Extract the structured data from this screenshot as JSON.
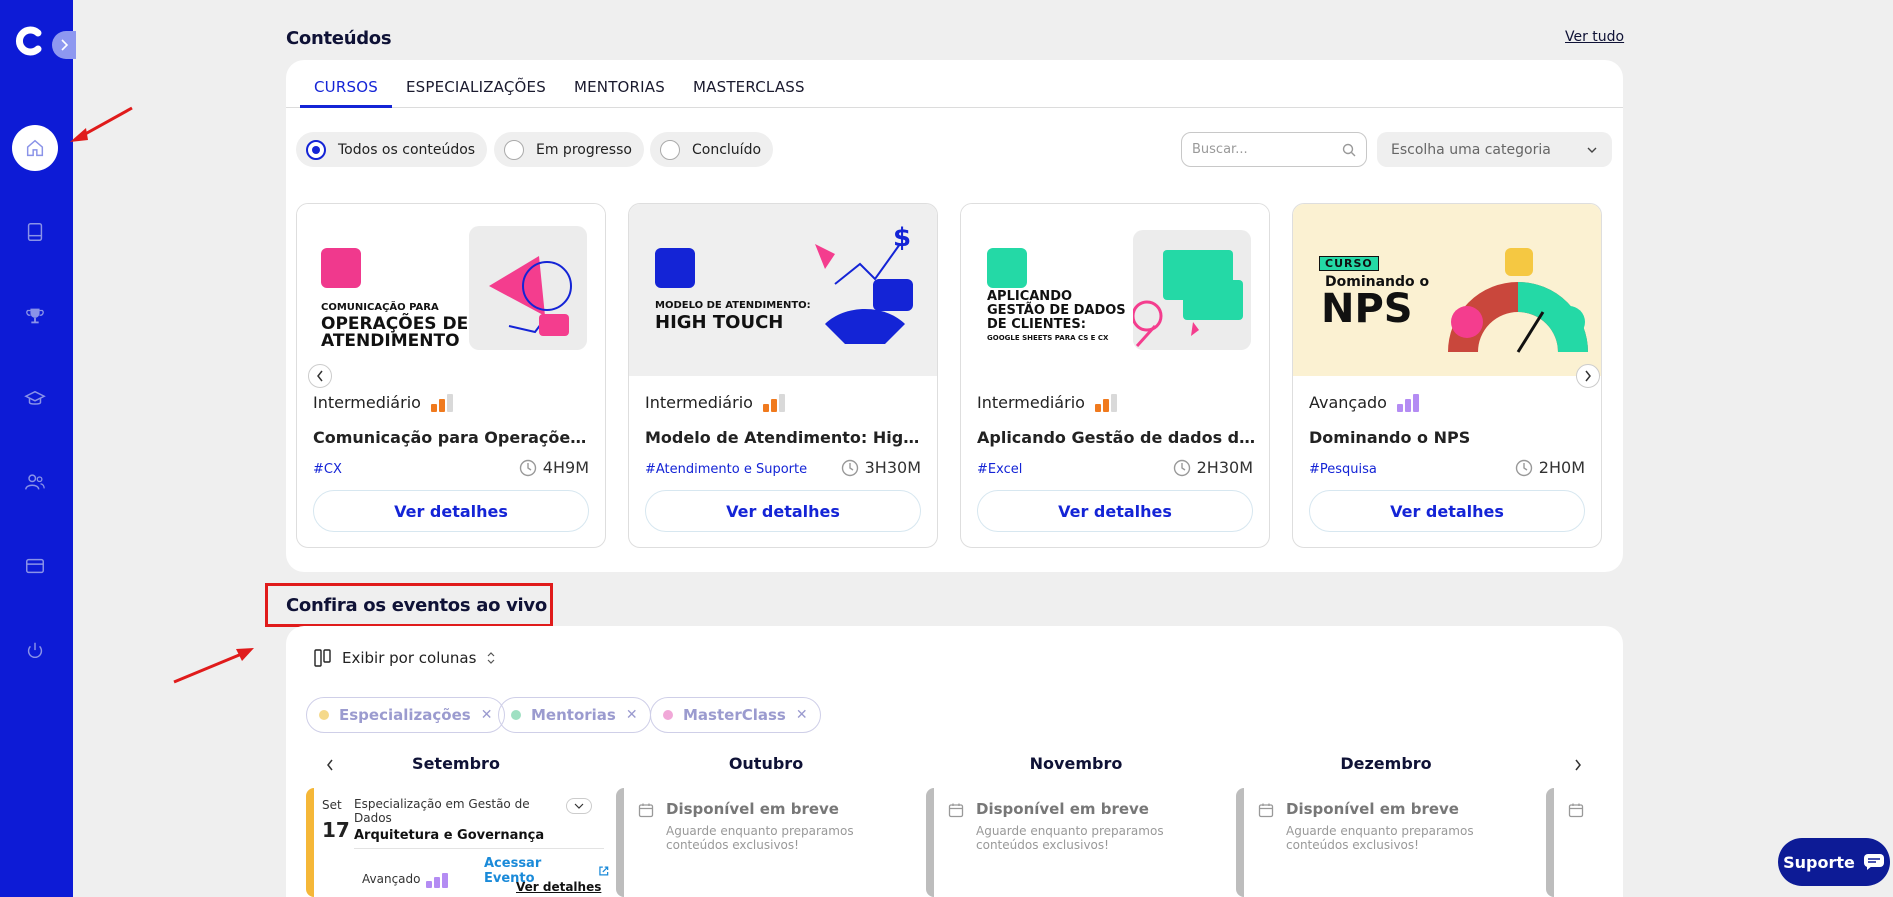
{
  "sidebar": {
    "items": [
      {
        "name": "home-icon"
      },
      {
        "name": "book-icon"
      },
      {
        "name": "trophy-icon"
      },
      {
        "name": "graduation-cap-icon"
      },
      {
        "name": "users-icon"
      },
      {
        "name": "credit-card-icon"
      },
      {
        "name": "power-icon"
      }
    ]
  },
  "contents": {
    "title": "Conteúdos",
    "see_all": "Ver tudo",
    "tabs": [
      "CURSOS",
      "ESPECIALIZAÇÕES",
      "MENTORIAS",
      "MASTERCLASS"
    ],
    "filters": [
      "Todos os conteúdos",
      "Em progresso",
      "Concluído"
    ],
    "search_placeholder": "Buscar...",
    "category_placeholder": "Escolha uma categoria",
    "cards": [
      {
        "thumb_line1": "COMUNICAÇÃO PARA",
        "thumb_line2": "OPERAÇÕES DE",
        "thumb_line3": "ATENDIMENTO",
        "level": "Intermediário",
        "title": "Comunicação para Operações ...",
        "tag": "#CX",
        "duration": "4H9M",
        "button": "Ver detalhes"
      },
      {
        "thumb_line1": "MODELO DE ATENDIMENTO:",
        "thumb_line2": "HIGH TOUCH",
        "level": "Intermediário",
        "title": "Modelo de Atendimento: High T...",
        "tag": "#Atendimento e Suporte",
        "duration": "3H30M",
        "button": "Ver detalhes"
      },
      {
        "thumb_line1": "APLICANDO",
        "thumb_line2": "GESTÃO DE DADOS",
        "thumb_line3": "DE CLIENTES:",
        "thumb_line4": "GOOGLE SHEETS PARA CS E CX",
        "level": "Intermediário",
        "title": "Aplicando Gestão de dados de c...",
        "tag": "#Excel",
        "duration": "2H30M",
        "button": "Ver detalhes"
      },
      {
        "thumb_badge": "CURSO",
        "thumb_line1": "Dominando o",
        "thumb_line2": "NPS",
        "level": "Avançado",
        "title": "Dominando o NPS",
        "tag": "#Pesquisa",
        "duration": "2H0M",
        "button": "Ver detalhes"
      }
    ]
  },
  "events": {
    "title": "Confira os eventos ao vivo",
    "view_mode": "Exibir por colunas",
    "chips": [
      {
        "label": "Especializações",
        "color": "#f5d98a"
      },
      {
        "label": "Mentorias",
        "color": "#9fe0c2"
      },
      {
        "label": "MasterClass",
        "color": "#f1a8d8"
      }
    ],
    "months": [
      "Setembro",
      "Outubro",
      "Novembro",
      "Dezembro"
    ],
    "first_event": {
      "month_abbr": "Set",
      "day": "17",
      "category": "Especialização em Gestão de Dados",
      "name": "Arquitetura e Governança",
      "access": "Acessar Evento",
      "level": "Avançado",
      "details": "Ver detalhes"
    },
    "placeholder_title": "Disponível em breve",
    "placeholder_sub": "Aguarde enquanto preparamos conteúdos exclusivos!"
  },
  "support": {
    "label": "Suporte"
  }
}
